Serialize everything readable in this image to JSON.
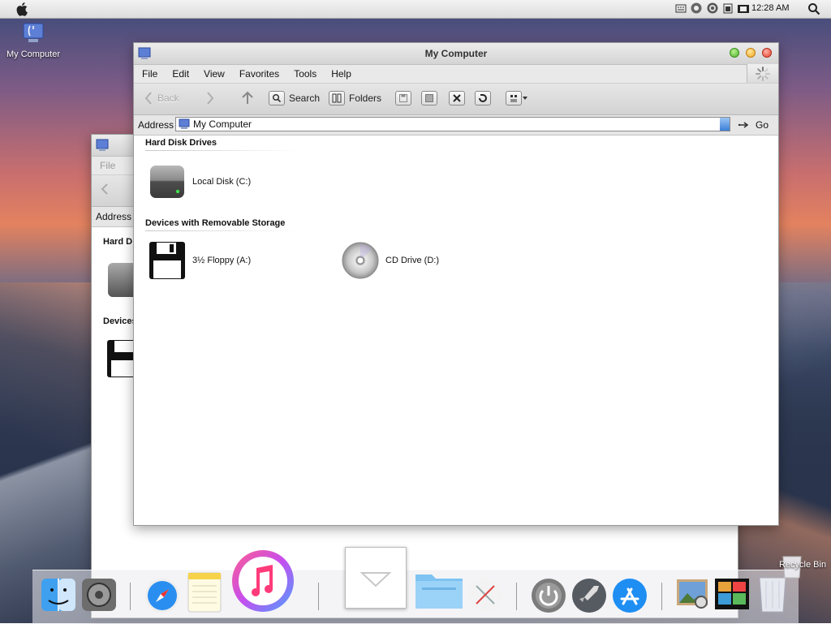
{
  "menubar": {
    "clock": "12:28 AM",
    "tray_icons": [
      "keyboard-icon",
      "gear-icon",
      "network-icon",
      "battery-icon",
      "volume-icon"
    ]
  },
  "desktop": {
    "icon_label": "My Computer",
    "recycle_label": "Recycle Bin"
  },
  "window": {
    "title": "My Computer",
    "menus": [
      "File",
      "Edit",
      "View",
      "Favorites",
      "Tools",
      "Help"
    ],
    "toolbar": {
      "back": "Back",
      "search": "Search",
      "folders": "Folders"
    },
    "address": {
      "label": "Address",
      "value": "My Computer",
      "go": "Go"
    },
    "sections": [
      {
        "title": "Hard Disk Drives",
        "items": [
          {
            "label": "Local Disk (C:)",
            "icon": "hard-disk-icon"
          }
        ]
      },
      {
        "title": "Devices with Removable Storage",
        "items": [
          {
            "label": "3½ Floppy (A:)",
            "icon": "floppy-icon"
          },
          {
            "label": "CD Drive (D:)",
            "icon": "cd-drive-icon"
          }
        ]
      }
    ]
  },
  "back_window": {
    "menu_file": "File",
    "address_label": "Address",
    "section1": "Hard D",
    "section2": "Devices"
  },
  "dock": {
    "apps": [
      "finder-icon",
      "system-preferences-icon",
      "safari-icon",
      "notes-icon",
      "itunes-icon",
      "downloads-stack-icon",
      "folder-icon",
      "x-app-icon",
      "power-icon",
      "launchpad-icon",
      "app-store-icon",
      "preview-icon",
      "photo-booth-icon",
      "trash-icon"
    ]
  }
}
